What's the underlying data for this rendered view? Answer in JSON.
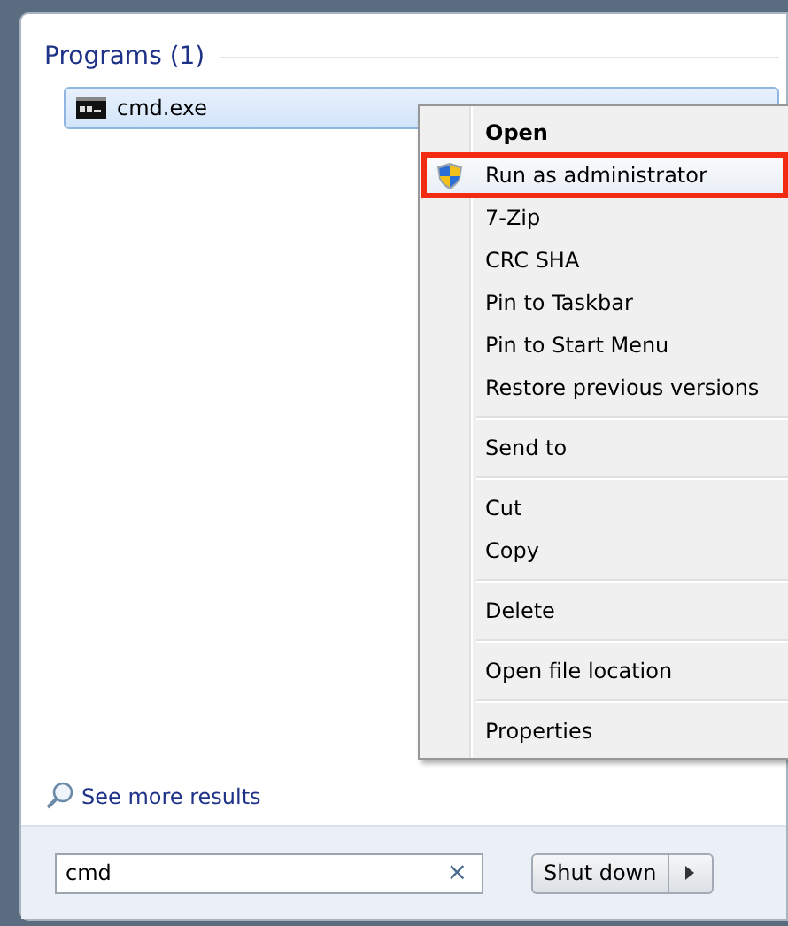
{
  "section": {
    "title": "Programs (1)"
  },
  "program": {
    "name": "cmd.exe",
    "selected": true
  },
  "context_menu": [
    {
      "kind": "item",
      "label": "Open",
      "default": true,
      "highlighted": false,
      "shield": false
    },
    {
      "kind": "item",
      "label": "Run as administrator",
      "default": false,
      "highlighted": true,
      "shield": true
    },
    {
      "kind": "item",
      "label": "7-Zip",
      "default": false,
      "highlighted": false,
      "shield": false
    },
    {
      "kind": "item",
      "label": "CRC SHA",
      "default": false,
      "highlighted": false,
      "shield": false
    },
    {
      "kind": "item",
      "label": "Pin to Taskbar",
      "default": false,
      "highlighted": false,
      "shield": false
    },
    {
      "kind": "item",
      "label": "Pin to Start Menu",
      "default": false,
      "highlighted": false,
      "shield": false
    },
    {
      "kind": "item",
      "label": "Restore previous versions",
      "default": false,
      "highlighted": false,
      "shield": false
    },
    {
      "kind": "separator"
    },
    {
      "kind": "item",
      "label": "Send to",
      "default": false,
      "highlighted": false,
      "shield": false
    },
    {
      "kind": "separator"
    },
    {
      "kind": "item",
      "label": "Cut",
      "default": false,
      "highlighted": false,
      "shield": false
    },
    {
      "kind": "item",
      "label": "Copy",
      "default": false,
      "highlighted": false,
      "shield": false
    },
    {
      "kind": "separator"
    },
    {
      "kind": "item",
      "label": "Delete",
      "default": false,
      "highlighted": false,
      "shield": false
    },
    {
      "kind": "separator"
    },
    {
      "kind": "item",
      "label": "Open file location",
      "default": false,
      "highlighted": false,
      "shield": false
    },
    {
      "kind": "separator"
    },
    {
      "kind": "item",
      "label": "Properties",
      "default": false,
      "highlighted": false,
      "shield": false
    }
  ],
  "see_more": {
    "label": "See more results"
  },
  "search": {
    "value": "cmd",
    "clear": "×"
  },
  "shutdown": {
    "label": "Shut down"
  }
}
